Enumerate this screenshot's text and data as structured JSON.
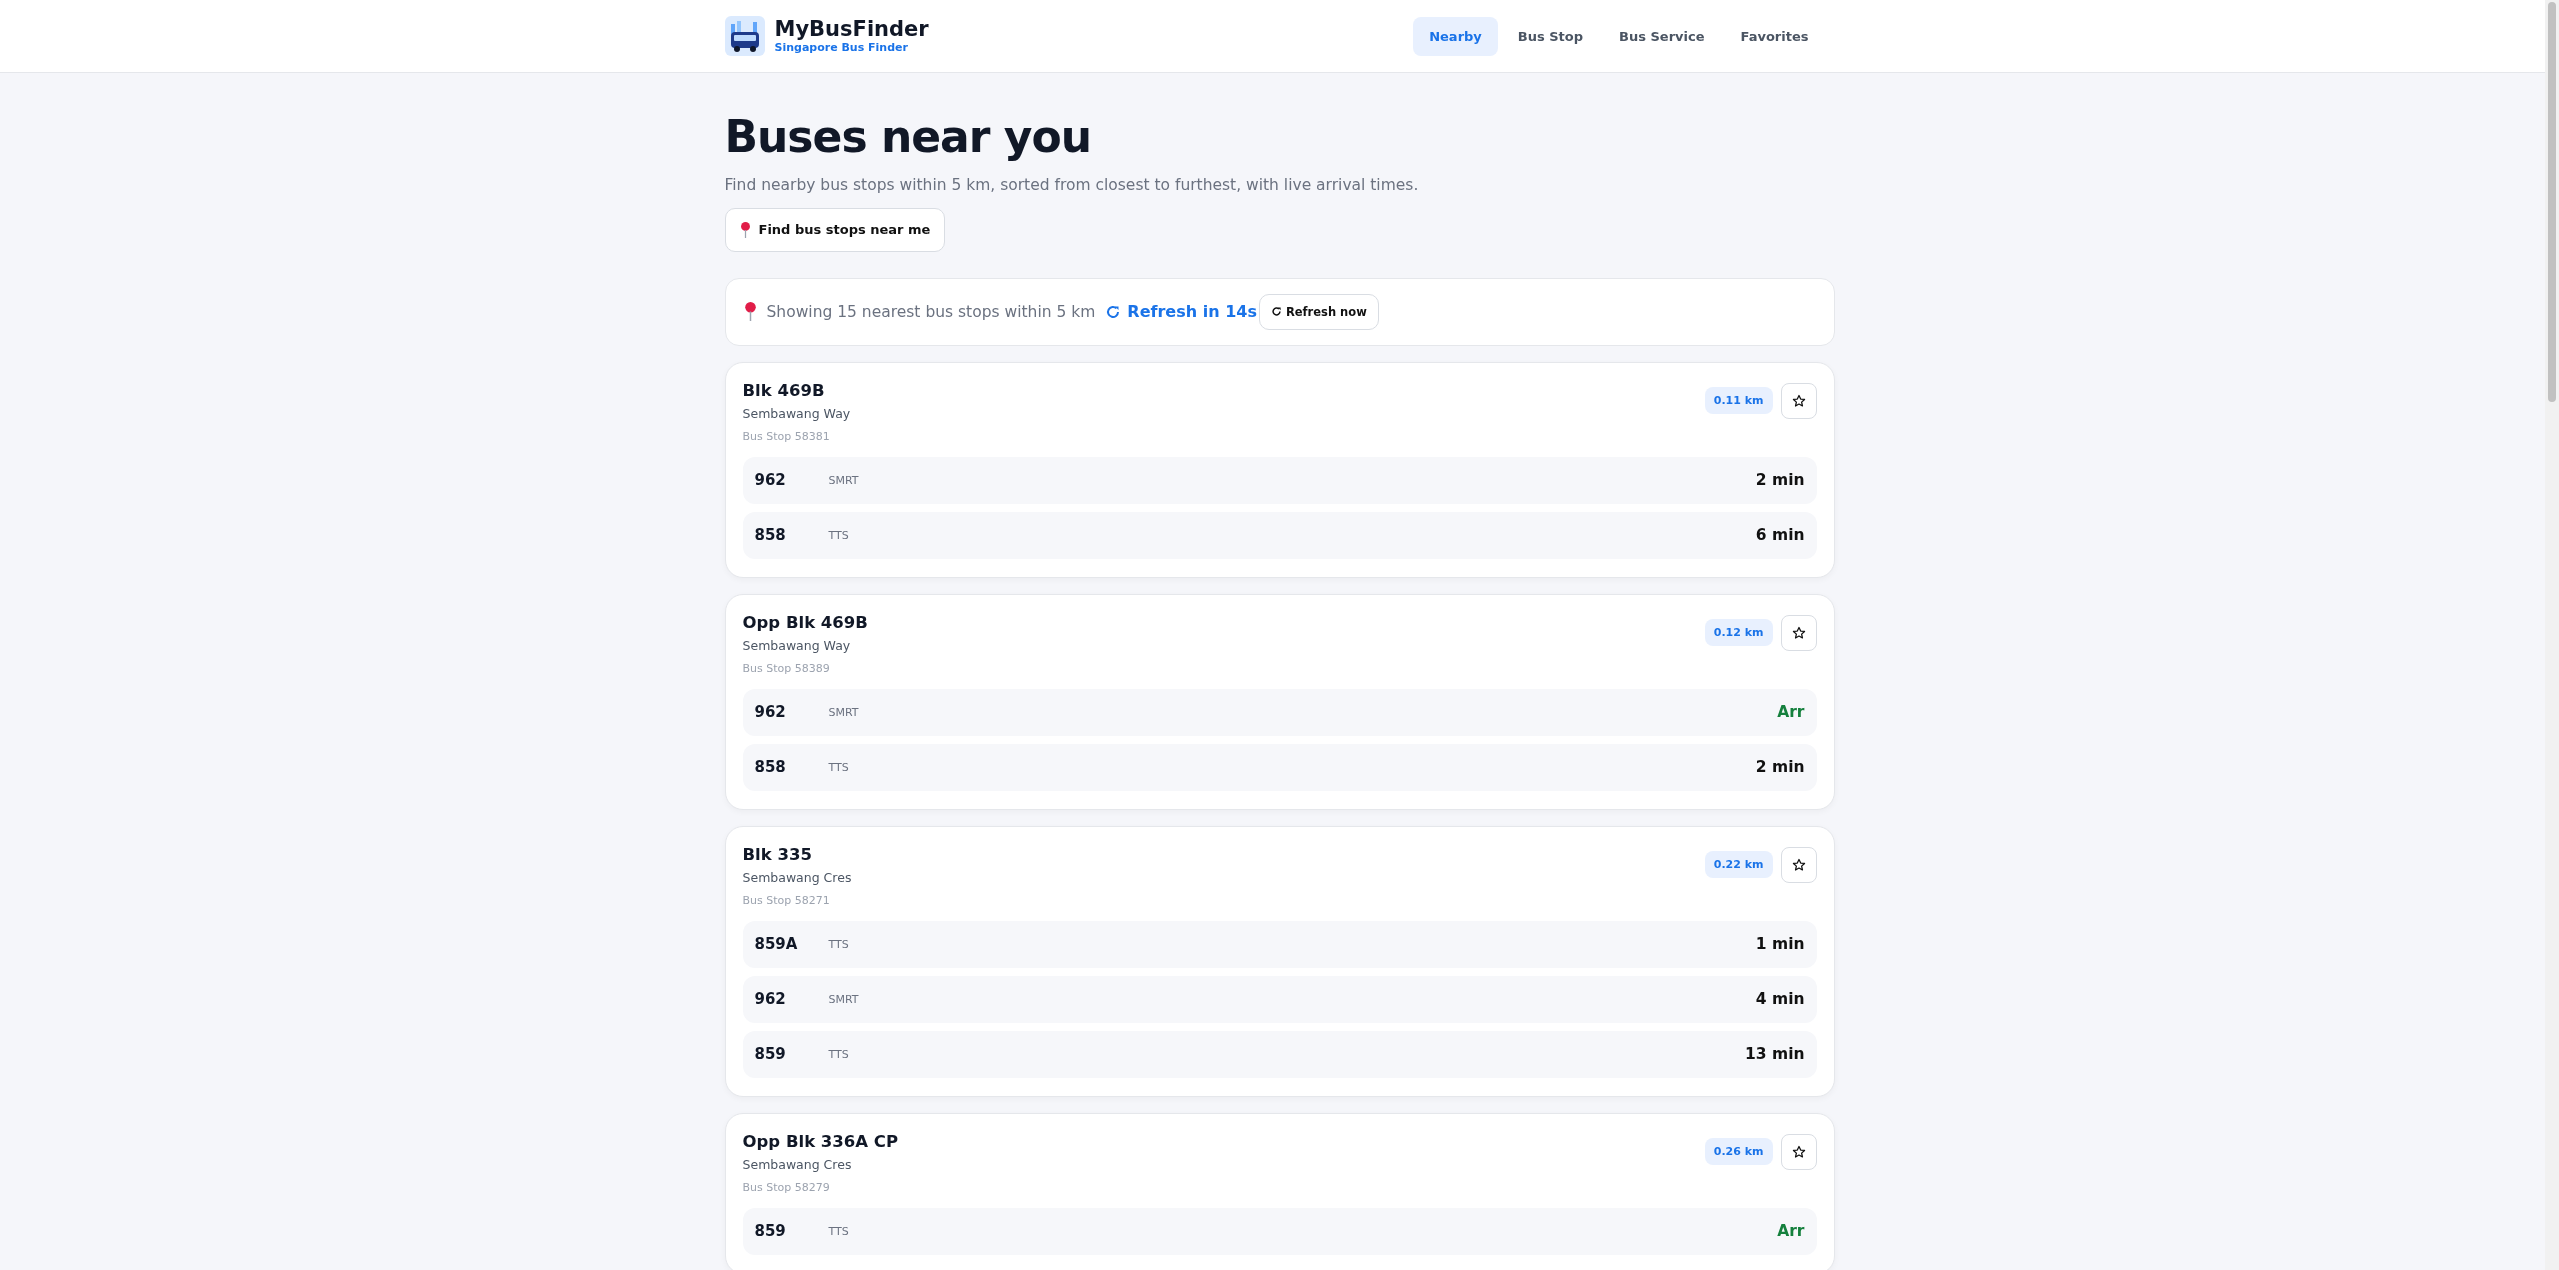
{
  "header": {
    "brand": "MyBusFinder",
    "tagline": "Singapore Bus Finder",
    "nav": [
      {
        "label": "Nearby",
        "selected": true
      },
      {
        "label": "Bus Stop",
        "selected": false
      },
      {
        "label": "Bus Service",
        "selected": false
      },
      {
        "label": "Favorites",
        "selected": false
      }
    ]
  },
  "page": {
    "title": "Buses near you",
    "subtitle": "Find nearby bus stops within 5 km, sorted from closest to furthest, with live arrival times.",
    "locate_button": "Find bus stops near me"
  },
  "status": {
    "text": "Showing 15 nearest bus stops within 5 km",
    "countdown": "Refresh in 14s",
    "refresh_button": "Refresh now"
  },
  "stops": [
    {
      "name": "Blk 469B",
      "road": "Sembawang Way",
      "code": "Bus Stop 58381",
      "distance": "0.11 km",
      "favorite": false,
      "services": [
        {
          "number": "962",
          "operator": "SMRT",
          "eta": "2 min",
          "arriving": false
        },
        {
          "number": "858",
          "operator": "TTS",
          "eta": "6 min",
          "arriving": false
        }
      ]
    },
    {
      "name": "Opp Blk 469B",
      "road": "Sembawang Way",
      "code": "Bus Stop 58389",
      "distance": "0.12 km",
      "favorite": false,
      "services": [
        {
          "number": "962",
          "operator": "SMRT",
          "eta": "Arr",
          "arriving": true
        },
        {
          "number": "858",
          "operator": "TTS",
          "eta": "2 min",
          "arriving": false
        }
      ]
    },
    {
      "name": "Blk 335",
      "road": "Sembawang Cres",
      "code": "Bus Stop 58271",
      "distance": "0.22 km",
      "favorite": false,
      "services": [
        {
          "number": "859A",
          "operator": "TTS",
          "eta": "1 min",
          "arriving": false
        },
        {
          "number": "962",
          "operator": "SMRT",
          "eta": "4 min",
          "arriving": false
        },
        {
          "number": "859",
          "operator": "TTS",
          "eta": "13 min",
          "arriving": false
        }
      ]
    },
    {
      "name": "Opp Blk 336A CP",
      "road": "Sembawang Cres",
      "code": "Bus Stop 58279",
      "distance": "0.26 km",
      "favorite": false,
      "services": [
        {
          "number": "859",
          "operator": "TTS",
          "eta": "Arr",
          "arriving": true
        }
      ]
    }
  ]
}
